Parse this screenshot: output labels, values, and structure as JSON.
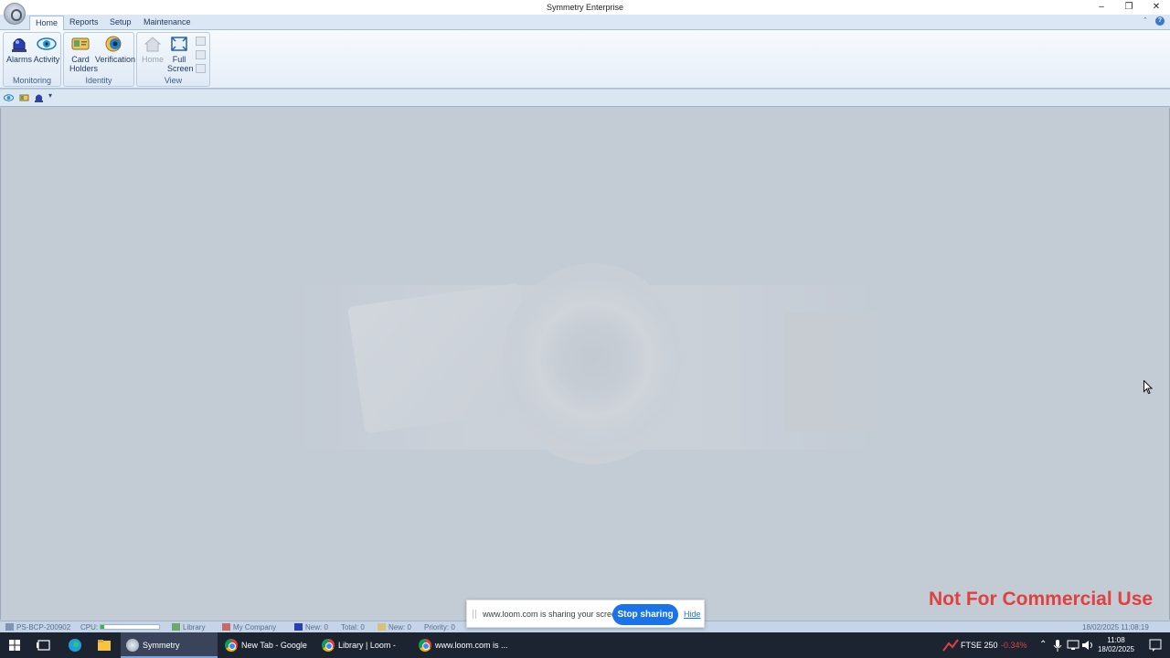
{
  "window": {
    "title": "Symmetry Enterprise"
  },
  "ribbon": {
    "tabs": [
      {
        "label": "Home",
        "active": true
      },
      {
        "label": "Reports",
        "active": false
      },
      {
        "label": "Setup",
        "active": false
      },
      {
        "label": "Maintenance",
        "active": false
      }
    ],
    "groups": [
      {
        "label": "Monitoring",
        "buttons": [
          {
            "label": "Alarms",
            "icon": "alarm-icon"
          },
          {
            "label": "Activity",
            "icon": "eye-icon"
          }
        ]
      },
      {
        "label": "Identity",
        "buttons": [
          {
            "label": "Card Holders",
            "icon": "card-holders-icon"
          },
          {
            "label": "Verification",
            "icon": "verification-icon"
          }
        ]
      },
      {
        "label": "View",
        "buttons": [
          {
            "label": "Home",
            "icon": "home-icon",
            "disabled": true
          },
          {
            "label": "Full Screen",
            "icon": "full-screen-icon"
          }
        ]
      }
    ]
  },
  "workspace": {
    "watermark_notice": "Not For Commercial Use"
  },
  "statusbar": {
    "computer": "PS-BCP-200902",
    "cpu_label": "CPU:",
    "cpu_level": 0.06,
    "library": "Library",
    "company": "My Company",
    "alarms_new": "New: 0",
    "alarms_total": "Total: 0",
    "cards_new": "New: 0",
    "priority": "Priority: 0",
    "datetime": "18/02/2025 11:08:19"
  },
  "loom": {
    "message": "www.loom.com is sharing your screen.",
    "stop_label": "Stop sharing",
    "hide_label": "Hide"
  },
  "taskbar": {
    "apps": [
      {
        "label": "Symmetry Enterprise",
        "active": true
      },
      {
        "label": "New Tab - Google ...",
        "active": false
      },
      {
        "label": "Library | Loom - Go...",
        "active": false
      },
      {
        "label": "www.loom.com is ...",
        "active": false
      }
    ],
    "ticker_name": "FTSE 250",
    "ticker_change": "-0.34%",
    "time": "11:08",
    "date": "18/02/2025"
  },
  "colors": {
    "accent": "#1a73e8",
    "ticker_negative": "#e0413e",
    "notice": "#e0413e"
  }
}
